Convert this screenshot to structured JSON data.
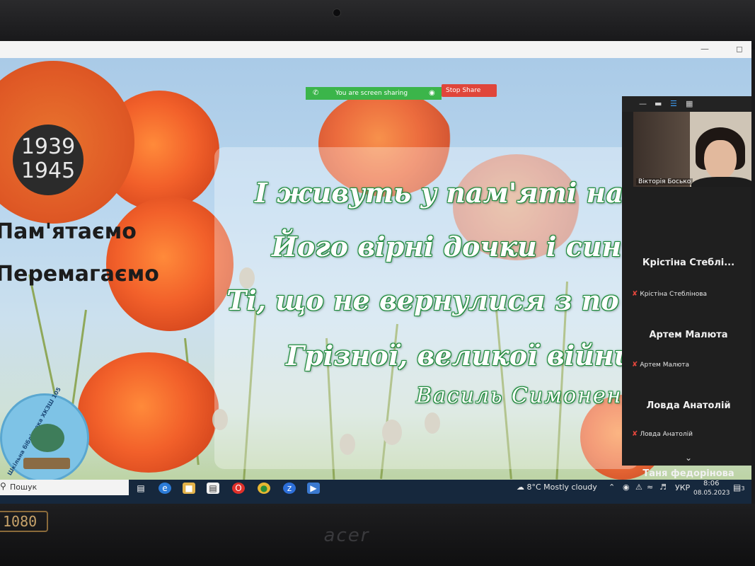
{
  "slide": {
    "years_start": "1939",
    "years_end": "1945",
    "slogan_line1": "Пам'ятаємо",
    "slogan_line2": "Перемагаємо",
    "library_logo_text": "Шкільна бібліотека ХКЗШ 105",
    "poem": [
      "І живуть у пам'яті на",
      "Його вірні дочки і син",
      "Ті, що не вернулися з по",
      "Грізної, великої війни"
    ],
    "author": "Василь Симонен"
  },
  "zoom": {
    "sharing_text": "You are screen sharing",
    "stop_share_label": "Stop Share",
    "video_participant": "Вікторія Босько",
    "participants": [
      {
        "name": "Крістіна Стеблі...",
        "sub": "Крістіна Стеблінова"
      },
      {
        "name": "Артем Малюта",
        "sub": "Артем Малюта"
      },
      {
        "name": "Ловда Анатолій",
        "sub": "Ловда Анатолій"
      },
      {
        "name": "Таня федорінова",
        "sub": ""
      }
    ]
  },
  "taskbar": {
    "search_label": "Пошук",
    "weather": "8°C  Mostly cloudy",
    "language": "УКР",
    "time": "8:06",
    "date": "08.05.2023",
    "notification_count": "3"
  },
  "bezel": {
    "hd_badge": "1080",
    "brand": "acer"
  },
  "colors": {
    "share_green": "#3bb54a",
    "stop_red": "#e0463b",
    "poem_outline": "#1f8a3c",
    "poppy_orange": "#f2602a"
  }
}
